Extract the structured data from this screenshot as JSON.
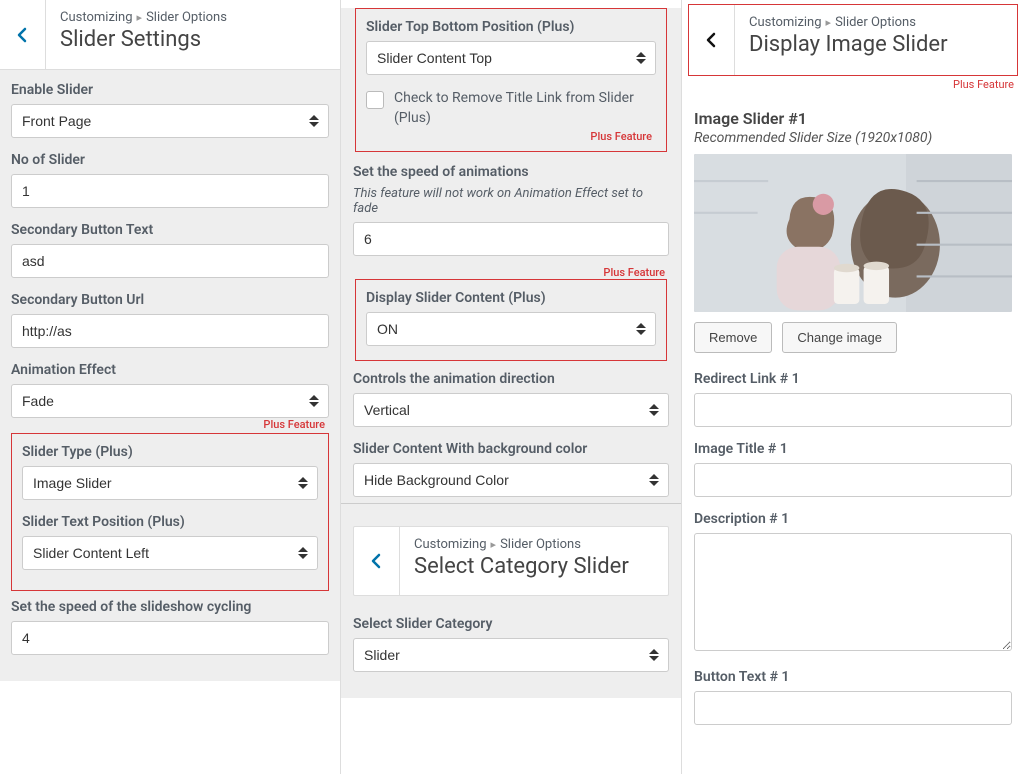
{
  "plus_feature_label": "Plus Feature",
  "col1": {
    "header": {
      "breadcrumb_a": "Customizing",
      "breadcrumb_b": "Slider Options",
      "title": "Slider Settings"
    },
    "enable_slider": {
      "label": "Enable Slider",
      "value": "Front Page"
    },
    "no_of_slider": {
      "label": "No of Slider",
      "value": "1"
    },
    "secondary_button_text": {
      "label": "Secondary Button Text",
      "value": "asd"
    },
    "secondary_button_url": {
      "label": "Secondary Button Url",
      "value": "http://as"
    },
    "animation_effect": {
      "label": "Animation Effect",
      "value": "Fade"
    },
    "slider_type": {
      "label": "Slider Type (Plus)",
      "value": "Image Slider"
    },
    "slider_text_position": {
      "label": "Slider Text Position (Plus)",
      "value": "Slider Content Left"
    },
    "speed_slideshow": {
      "label": "Set the speed of the slideshow cycling",
      "value": "4"
    }
  },
  "col2": {
    "top_bottom_position": {
      "label": "Slider Top Bottom Position (Plus)",
      "value": "Slider Content Top"
    },
    "remove_title_link": {
      "label": "Check to Remove Title Link from Slider (Plus)"
    },
    "speed_animations": {
      "label": "Set the speed of animations",
      "hint": "This feature will not work on Animation Effect set to fade",
      "value": "6"
    },
    "display_slider_content": {
      "label": "Display Slider Content (Plus)",
      "value": "ON"
    },
    "animation_direction": {
      "label": "Controls the animation direction",
      "value": "Vertical"
    },
    "content_bg_color": {
      "label": "Slider Content With background color",
      "value": "Hide Background Color"
    },
    "header2": {
      "breadcrumb_a": "Customizing",
      "breadcrumb_b": "Slider Options",
      "title": "Select Category Slider"
    },
    "select_category": {
      "label": "Select Slider Category",
      "value": "Slider"
    }
  },
  "col3": {
    "header": {
      "breadcrumb_a": "Customizing",
      "breadcrumb_b": "Slider Options",
      "title": "Display Image Slider"
    },
    "title": "Image Slider #1",
    "rec_size": "Recommended Slider Size (1920x1080)",
    "remove_label": "Remove",
    "change_label": "Change image",
    "redirect_link": {
      "label": "Redirect Link # 1",
      "value": ""
    },
    "image_title": {
      "label": "Image Title # 1",
      "value": ""
    },
    "description": {
      "label": "Description # 1",
      "value": ""
    },
    "button_text": {
      "label": "Button Text # 1",
      "value": ""
    }
  }
}
